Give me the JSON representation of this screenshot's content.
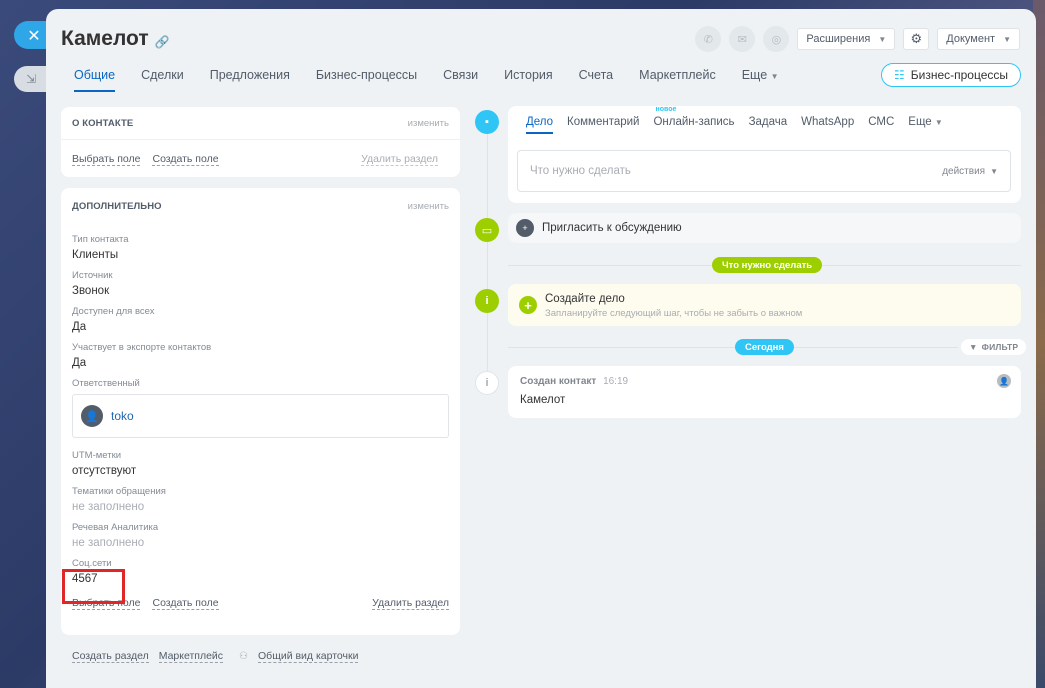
{
  "header": {
    "title": "Камелот",
    "extensions_label": "Расширения",
    "document_label": "Документ"
  },
  "tabs": [
    {
      "label": "Общие",
      "active": true
    },
    {
      "label": "Сделки"
    },
    {
      "label": "Предложения"
    },
    {
      "label": "Бизнес-процессы"
    },
    {
      "label": "Связи"
    },
    {
      "label": "История"
    },
    {
      "label": "Счета"
    },
    {
      "label": "Маркетплейс"
    },
    {
      "label": "Еще"
    }
  ],
  "bp_button_label": "Бизнес-процессы",
  "about_card": {
    "title": "О КОНТАКТЕ",
    "edit": "изменить",
    "choose_field": "Выбрать поле",
    "create_field": "Создать поле",
    "delete_section": "Удалить раздел"
  },
  "extra_card": {
    "title": "ДОПОЛНИТЕЛЬНО",
    "edit": "изменить",
    "fields": [
      {
        "label": "Тип контакта",
        "value": "Клиенты"
      },
      {
        "label": "Источник",
        "value": "Звонок"
      },
      {
        "label": "Доступен для всех",
        "value": "Да"
      },
      {
        "label": "Участвует в экспорте контактов",
        "value": "Да"
      }
    ],
    "responsible_label": "Ответственный",
    "responsible_name": "toko",
    "fields2": [
      {
        "label": "UTM-метки",
        "value": "отсутствуют"
      },
      {
        "label": "Тематики обращения",
        "value": "не заполнено"
      },
      {
        "label": "Речевая Аналитика",
        "value": "не заполнено"
      },
      {
        "label": "Соц.сети",
        "value": "4567"
      }
    ],
    "choose_field": "Выбрать поле",
    "create_field": "Создать поле",
    "delete_section": "Удалить раздел"
  },
  "bottom_links": {
    "create_section": "Создать раздел",
    "marketplace": "Маркетплейс",
    "card_view": "Общий вид карточки"
  },
  "timeline": {
    "composer_tabs": [
      {
        "label": "Дело",
        "active": true
      },
      {
        "label": "Комментарий"
      },
      {
        "label": "Онлайн-запись",
        "badge": "новое"
      },
      {
        "label": "Задача"
      },
      {
        "label": "WhatsApp"
      },
      {
        "label": "СМС"
      },
      {
        "label": "Еще"
      }
    ],
    "todo_placeholder": "Что нужно сделать",
    "actions_label": "действия",
    "invite_label": "Пригласить к обсуждению",
    "todo_pill": "Что нужно сделать",
    "create_title": "Создайте дело",
    "create_subtitle": "Запланируйте следующий шаг, чтобы не забыть о важном",
    "today_pill": "Сегодня",
    "filter_label": "ФИЛЬТР",
    "event_title": "Создан контакт",
    "event_time": "16:19",
    "event_body": "Камелот"
  },
  "colors": {
    "accent_blue": "#0b66c3",
    "timeline_blue": "#2fc6f6",
    "green": "#9dcf00",
    "highlight_red": "#e02626"
  }
}
